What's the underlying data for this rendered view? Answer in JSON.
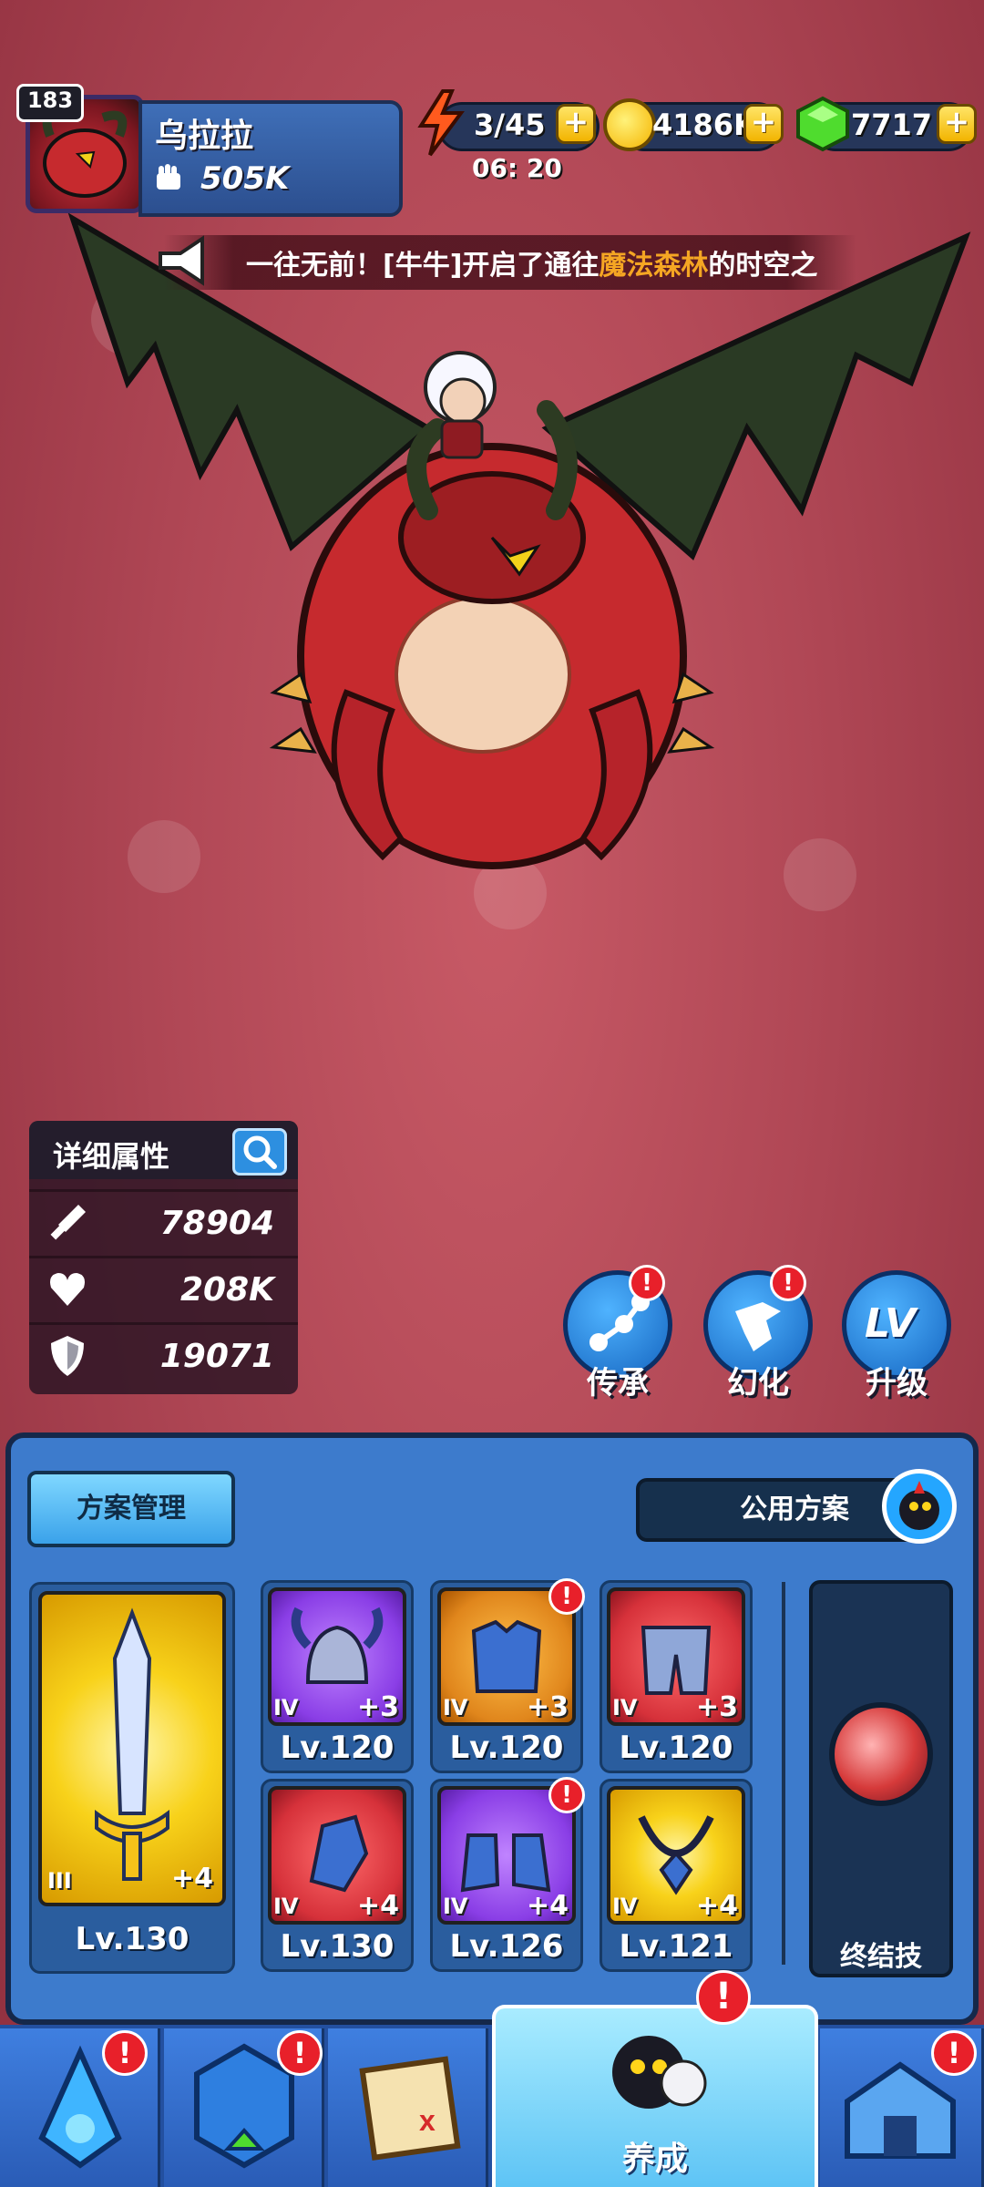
{
  "player": {
    "level": "183",
    "name": "乌拉拉",
    "power": "505K"
  },
  "resources": {
    "energy": "3/45",
    "energy_timer": "06: 20",
    "gold": "4186K",
    "gems": "7717",
    "plus": "+"
  },
  "broadcast": {
    "prefix": "一往无前！[牛牛]开启了通往",
    "highlight": "魔法森林",
    "suffix": "的时空之"
  },
  "stats": {
    "title": "详细属性",
    "attack": "78904",
    "hp": "208K",
    "defense": "19071"
  },
  "actions": [
    {
      "label": "传承",
      "alert": true
    },
    {
      "label": "幻化",
      "alert": true
    },
    {
      "label": "升级",
      "alert": false
    }
  ],
  "equipment_panel": {
    "plan_button": "方案管理",
    "public_plan": "公用方案",
    "weapon": {
      "tier": "III",
      "plus": "+4",
      "level": "Lv.130"
    },
    "slots": [
      {
        "tier": "IV",
        "plus": "+3",
        "level": "Lv.120",
        "color": "purple",
        "alert": false
      },
      {
        "tier": "IV",
        "plus": "+3",
        "level": "Lv.120",
        "color": "orange",
        "alert": true
      },
      {
        "tier": "IV",
        "plus": "+3",
        "level": "Lv.120",
        "color": "red",
        "alert": false
      },
      {
        "tier": "IV",
        "plus": "+4",
        "level": "Lv.130",
        "color": "red",
        "alert": false
      },
      {
        "tier": "IV",
        "plus": "+4",
        "level": "Lv.126",
        "color": "purple",
        "alert": true
      },
      {
        "tier": "IV",
        "plus": "+4",
        "level": "Lv.121",
        "color": "gold",
        "alert": false
      }
    ],
    "finisher_label": "终结技"
  },
  "bottom_nav": {
    "active_label": "养成",
    "alert_mark": "!"
  },
  "colors": {
    "accent_blue": "#3d7bcc",
    "alert_red": "#e8202a",
    "gold": "#f8d21a"
  }
}
